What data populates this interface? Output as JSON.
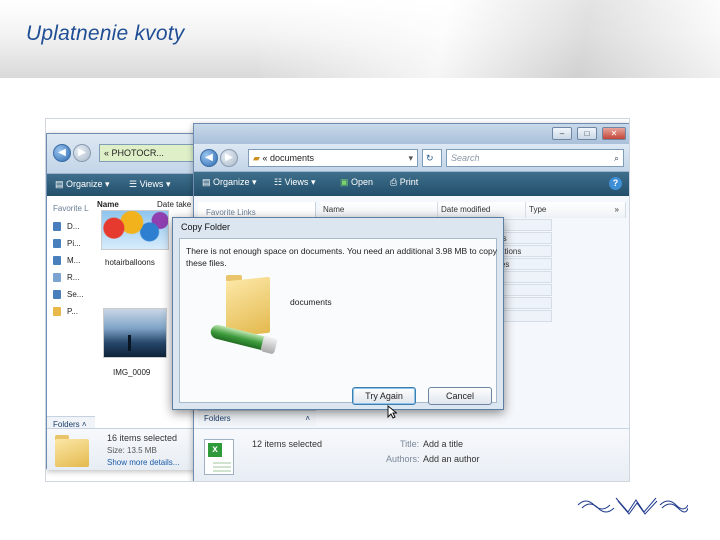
{
  "slide": {
    "title": "Uplatnenie kvoty"
  },
  "back_window": {
    "address": "« PHOTOCR...",
    "toolbar": {
      "organize": "Organize",
      "views": "Views"
    },
    "columns": {
      "name": "Name",
      "date": "Date take"
    },
    "nav_header": "Favorite L",
    "nav_items": [
      "D...",
      "Pi...",
      "M...",
      "R...",
      "Se...",
      "P..."
    ],
    "thumbnails": [
      {
        "label": "hotairballoons"
      },
      {
        "label": "IMG_0009"
      }
    ],
    "folders_label": "Folders",
    "details": {
      "count": "16 items selected",
      "size": "Size: 13.5 MB",
      "more": "Show more details..."
    }
  },
  "front_window": {
    "address": "«  documents",
    "search_placeholder": "Search",
    "toolbar": {
      "organize": "Organize",
      "views": "Views",
      "open": "Open",
      "print": "Print"
    },
    "nav_header": "Favorite Links",
    "columns": {
      "name": "Name",
      "date": "Date modified",
      "type": "Type"
    },
    "list_rows": [
      "nue",
      "skets",
      "lculations",
      "enses",
      "ons"
    ],
    "folders_label": "Folders",
    "details": {
      "count": "12 items selected",
      "title_key": "Title:",
      "title_value": "Add a title",
      "authors_key": "Authors:",
      "authors_value": "Add an author"
    }
  },
  "dialog": {
    "title": "Copy Folder",
    "message": "There is not enough space on documents. You need an additional 3.98 MB to copy these files.",
    "folder_label": "documents",
    "try_again": "Try Again",
    "cancel": "Cancel"
  },
  "colors": {
    "title_blue": "#1f4e94",
    "toolbar_dark": "#234f6b",
    "logo_blue": "#1d3a8c"
  },
  "icons": [
    "back-arrow-icon",
    "forward-arrow-icon",
    "folder-icon",
    "search-icon",
    "help-icon",
    "mouse-cursor-icon",
    "excel-file-icon",
    "brand-logo"
  ]
}
